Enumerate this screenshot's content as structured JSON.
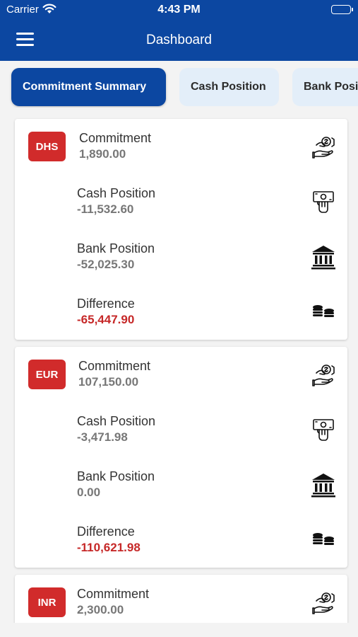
{
  "status_bar": {
    "carrier": "Carrier",
    "time": "4:43 PM"
  },
  "header": {
    "title": "Dashboard"
  },
  "tabs": [
    {
      "label": "Commitment Summary",
      "active": true
    },
    {
      "label": "Cash Position",
      "active": false
    },
    {
      "label": "Bank Position",
      "active": false
    }
  ],
  "cards": [
    {
      "currency": "DHS",
      "items": [
        {
          "label": "Commitment",
          "value": "1,890.00",
          "icon": "commitment-handshake-icon"
        },
        {
          "label": "Cash Position",
          "value": "-11,532.60",
          "icon": "cash-in-hand-icon"
        },
        {
          "label": "Bank Position",
          "value": "-52,025.30",
          "icon": "bank-icon"
        },
        {
          "label": "Difference",
          "value": "-65,447.90",
          "icon": "coins-icon"
        }
      ]
    },
    {
      "currency": "EUR",
      "items": [
        {
          "label": "Commitment",
          "value": "107,150.00",
          "icon": "commitment-handshake-icon"
        },
        {
          "label": "Cash Position",
          "value": "-3,471.98",
          "icon": "cash-in-hand-icon"
        },
        {
          "label": "Bank Position",
          "value": "0.00",
          "icon": "bank-icon"
        },
        {
          "label": "Difference",
          "value": "-110,621.98",
          "icon": "coins-icon"
        }
      ]
    },
    {
      "currency": "INR",
      "items": [
        {
          "label": "Commitment",
          "value": "2,300.00",
          "icon": "commitment-handshake-icon"
        }
      ]
    }
  ],
  "colors": {
    "header": "#0c47a1",
    "badge": "#d12b2b",
    "negative_difference": "#c62828",
    "inactive_tab": "#e3eef9"
  }
}
